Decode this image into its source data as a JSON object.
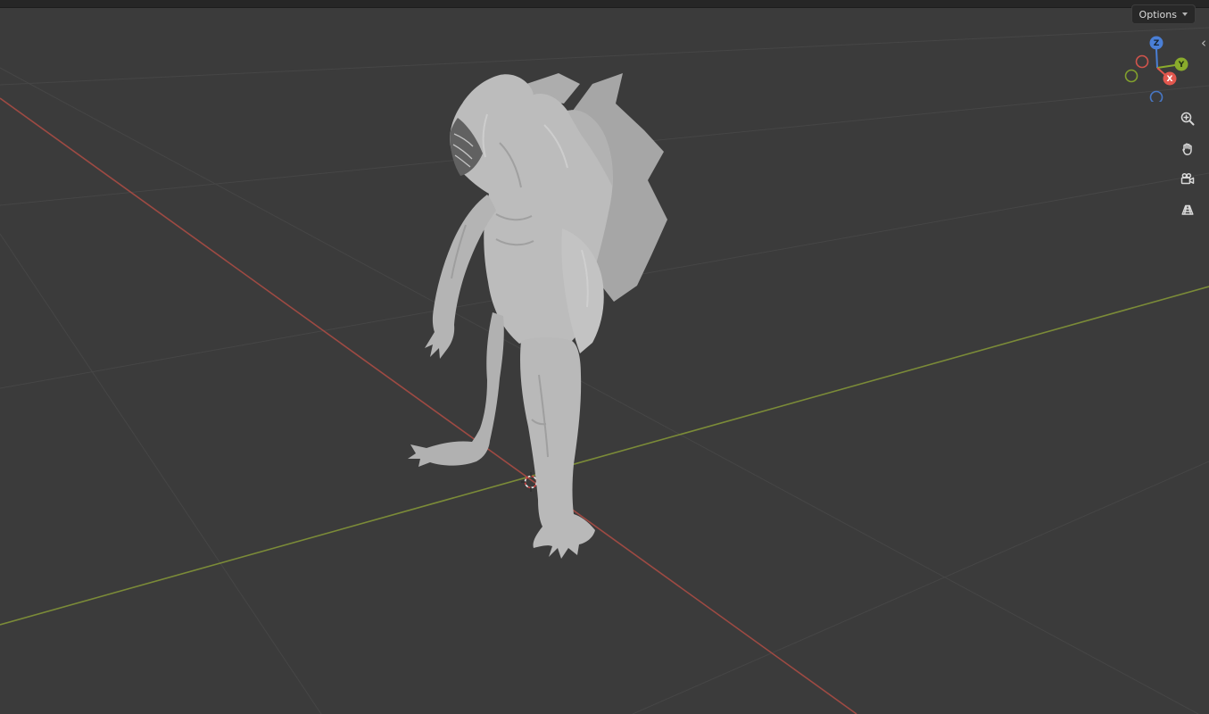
{
  "header": {
    "options_button": {
      "label": "Options"
    }
  },
  "gizmo": {
    "axes": [
      {
        "label": "Z",
        "color": "#4a7fd6"
      },
      {
        "label": "Y",
        "color": "#8aab2c"
      },
      {
        "label": "X",
        "color": "#e2574e"
      }
    ]
  },
  "toolbar": {
    "tools": [
      {
        "name": "zoom"
      },
      {
        "name": "pan"
      },
      {
        "name": "camera-view"
      },
      {
        "name": "toggle-projection"
      }
    ]
  },
  "viewport": {
    "background_color": "#3b3b3b",
    "grid_color": "#464646",
    "x_axis_color": "#9e4a43",
    "y_axis_color": "#7b8b38",
    "model_color": "#bcbcbc"
  },
  "sidebar_toggle": {
    "glyph": "‹"
  }
}
